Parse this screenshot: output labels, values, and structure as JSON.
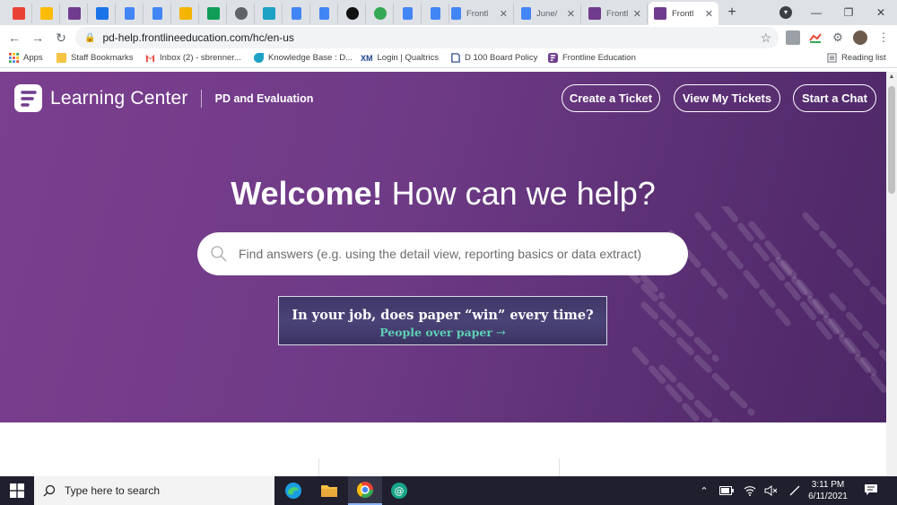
{
  "browser": {
    "pinned_tabs": [
      {
        "icon": "gmail-icon",
        "color": "#ea4335"
      },
      {
        "icon": "google-drive-icon",
        "color": "#fbbc04"
      },
      {
        "icon": "frontline-icon",
        "color": "#6f3c8e"
      },
      {
        "icon": "calendar-icon",
        "color": "#1a73e8"
      },
      {
        "icon": "google-docs-icon",
        "color": "#4285f4"
      },
      {
        "icon": "google-docs-icon",
        "color": "#4285f4"
      },
      {
        "icon": "google-slides-icon",
        "color": "#f4b400"
      },
      {
        "icon": "google-sheets-icon",
        "color": "#0f9d58"
      },
      {
        "icon": "globe-icon",
        "color": "#5f6368"
      },
      {
        "icon": "bird-icon",
        "color": "#1da1c4"
      },
      {
        "icon": "google-docs-icon",
        "color": "#4285f4"
      },
      {
        "icon": "google-docs-icon",
        "color": "#4285f4"
      },
      {
        "icon": "black-circle-icon",
        "color": "#111111"
      },
      {
        "icon": "stripes-icon",
        "color": "#34a853"
      },
      {
        "icon": "google-docs-icon",
        "color": "#4285f4"
      },
      {
        "icon": "google-docs-icon",
        "color": "#4285f4"
      }
    ],
    "tabs": [
      {
        "title": "Frontl",
        "icon": "google-docs-icon",
        "color": "#4285f4"
      },
      {
        "title": "June/",
        "icon": "google-docs-icon",
        "color": "#4285f4"
      },
      {
        "title": "Frontl",
        "icon": "frontline-icon",
        "color": "#6f3c8e"
      },
      {
        "title": "Frontl",
        "icon": "frontline-icon",
        "color": "#6f3c8e",
        "active": true
      }
    ],
    "url": "pd-help.frontlineeducation.com/hc/en-us",
    "bookmarks": [
      {
        "label": "Apps",
        "icon": "apps-grid-icon"
      },
      {
        "label": "Staff Bookmarks",
        "icon": "folder-icon"
      },
      {
        "label": "Inbox (2) - sbrenner...",
        "icon": "gmail-icon"
      },
      {
        "label": "Knowledge Base : D...",
        "icon": "bird-icon"
      },
      {
        "label": "Login | Qualtrics",
        "icon": "qualtrics-icon",
        "prefix": "XM"
      },
      {
        "label": "D 100 Board Policy",
        "icon": "policy-icon"
      },
      {
        "label": "Frontline Education",
        "icon": "frontline-icon"
      }
    ],
    "reading_list": "Reading list"
  },
  "site": {
    "brand": "Learning Center",
    "product": "PD and Evaluation",
    "buttons": {
      "create_ticket": "Create a Ticket",
      "view_tickets": "View My Tickets",
      "start_chat": "Start a Chat"
    },
    "welcome_bold": "Welcome!",
    "welcome_rest": "How can we help?",
    "search_placeholder": "Find answers (e.g. using the detail view, reporting basics or data extract)",
    "banner": {
      "line1": "In your job, does paper “win” every time?",
      "line2": "People over paper ⇢"
    }
  },
  "taskbar": {
    "search_text": "Type here to search",
    "time": "3:11 PM",
    "date": "6/11/2021"
  },
  "colors": {
    "hero": "#6e3a86",
    "accent_green": "#5fd1b6"
  }
}
